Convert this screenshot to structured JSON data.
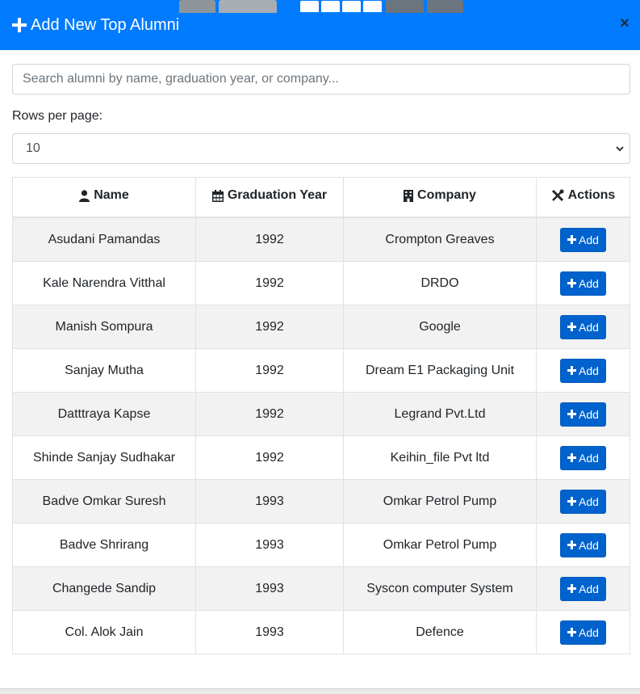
{
  "modal": {
    "title": "Add New Top Alumni",
    "close_label": "×"
  },
  "search": {
    "placeholder": "Search alumni by name, graduation year, or company..."
  },
  "rows_per_page": {
    "label": "Rows per page:",
    "value": "10"
  },
  "table": {
    "headers": {
      "name": "Name",
      "year": "Graduation Year",
      "company": "Company",
      "actions": "Actions"
    },
    "action_label": "Add",
    "rows": [
      {
        "name": "Asudani Pamandas",
        "year": "1992",
        "company": "Crompton Greaves"
      },
      {
        "name": "Kale Narendra Vitthal",
        "year": "1992",
        "company": "DRDO"
      },
      {
        "name": "Manish Sompura",
        "year": "1992",
        "company": "Google"
      },
      {
        "name": "Sanjay Mutha",
        "year": "1992",
        "company": "Dream E1 Packaging Unit"
      },
      {
        "name": "Datttraya Kapse",
        "year": "1992",
        "company": "Legrand Pvt.Ltd"
      },
      {
        "name": "Shinde Sanjay Sudhakar",
        "year": "1992",
        "company": "Keihin_file Pvt ltd"
      },
      {
        "name": "Badve Omkar Suresh",
        "year": "1993",
        "company": "Omkar Petrol Pump"
      },
      {
        "name": "Badve Shrirang",
        "year": "1993",
        "company": "Omkar Petrol Pump"
      },
      {
        "name": "Changede Sandip",
        "year": "1993",
        "company": "Syscon computer System"
      },
      {
        "name": "Col. Alok Jain",
        "year": "1993",
        "company": "Defence"
      }
    ]
  },
  "colors": {
    "header_bg": "#007bff",
    "add_button": "#0062cc",
    "striped_row": "#f2f2f2"
  }
}
